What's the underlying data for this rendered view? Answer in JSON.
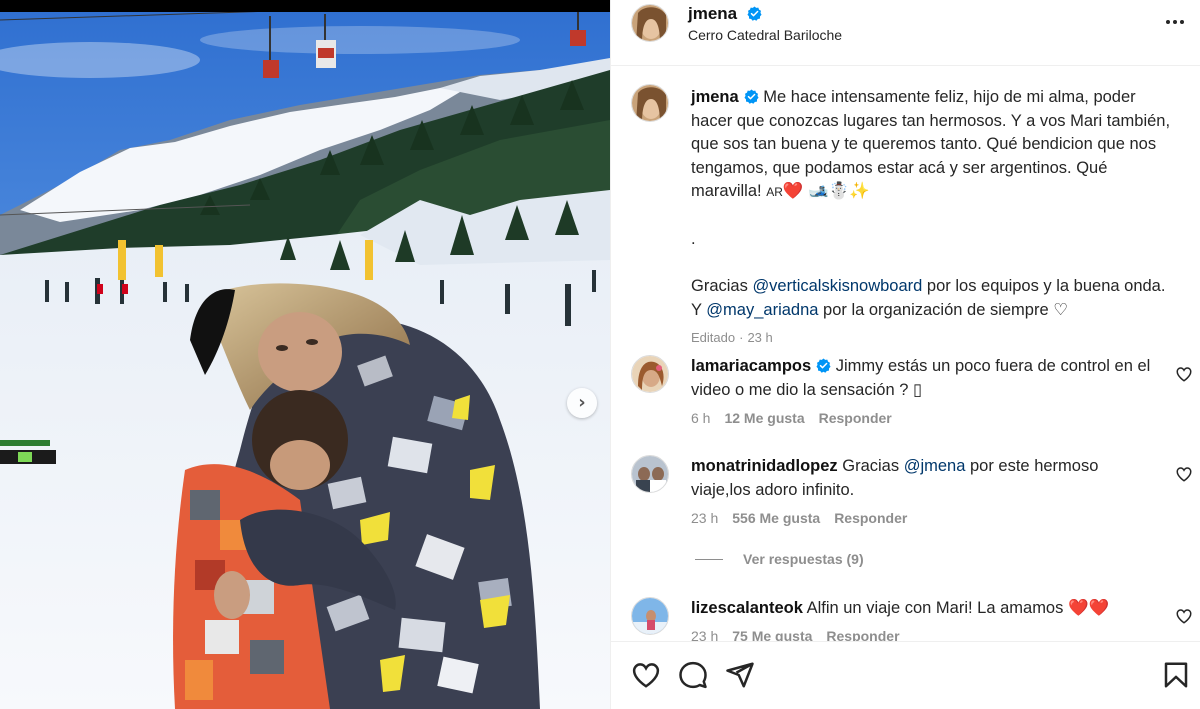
{
  "post": {
    "username": "jmena",
    "location": "Cerro Catedral Bariloche",
    "caption_parts": {
      "p1": "Me hace intensamente feliz, hijo de mi alma, poder hacer que conozcas lugares tan hermosos. Y a vos Mari también, que sos tan buena y te queremos tanto. Qué bendicion que nos tengamos, que podamos estar acá y ser argentinos. Qué maravilla! ",
      "flag": "AR",
      "emojis": "❤️ 🎿☃️✨",
      "dot": ".",
      "thanks1_a": "Gracias ",
      "thanks1_mention": "@verticalskisnowboard",
      "thanks1_b": " por los equipos y la buena onda.",
      "thanks2_a": "Y ",
      "thanks2_mention": "@may_ariadna",
      "thanks2_b": " por la organización de siempre ",
      "thanks2_heart": "♡"
    },
    "edited_label": "Editado",
    "edited_time": "23 h"
  },
  "comments": [
    {
      "username": "lamariacampos",
      "text": "Jimmy estás un poco fuera de control en el video o me dio la sensación ? ▯",
      "time": "6 h",
      "likes": "12 Me gusta",
      "reply": "Responder"
    },
    {
      "username": "monatrinidadlopez",
      "text_a": "Gracias ",
      "mention": "@jmena",
      "text_b": " por este hermoso viaje,los adoro infinito.",
      "time": "23 h",
      "likes": "556 Me gusta",
      "reply": "Responder",
      "view_replies": "Ver respuestas (9)"
    },
    {
      "username": "lizescalanteok",
      "text": "Alfin un viaje con Mari! La amamos ",
      "hearts": "❤️❤️",
      "time": "23 h",
      "likes": "75 Me gusta",
      "reply": "Responder"
    }
  ],
  "icons": {
    "verified": "verified-badge-icon",
    "more": "more-options-icon",
    "like": "heart-icon",
    "comment": "comment-icon",
    "share": "share-icon",
    "save": "bookmark-icon",
    "next": "chevron-right-icon"
  },
  "colors": {
    "verified_blue": "#0095f6",
    "mention": "#00376b",
    "muted": "#8e8e8e",
    "heart_red": "#e0245e"
  }
}
